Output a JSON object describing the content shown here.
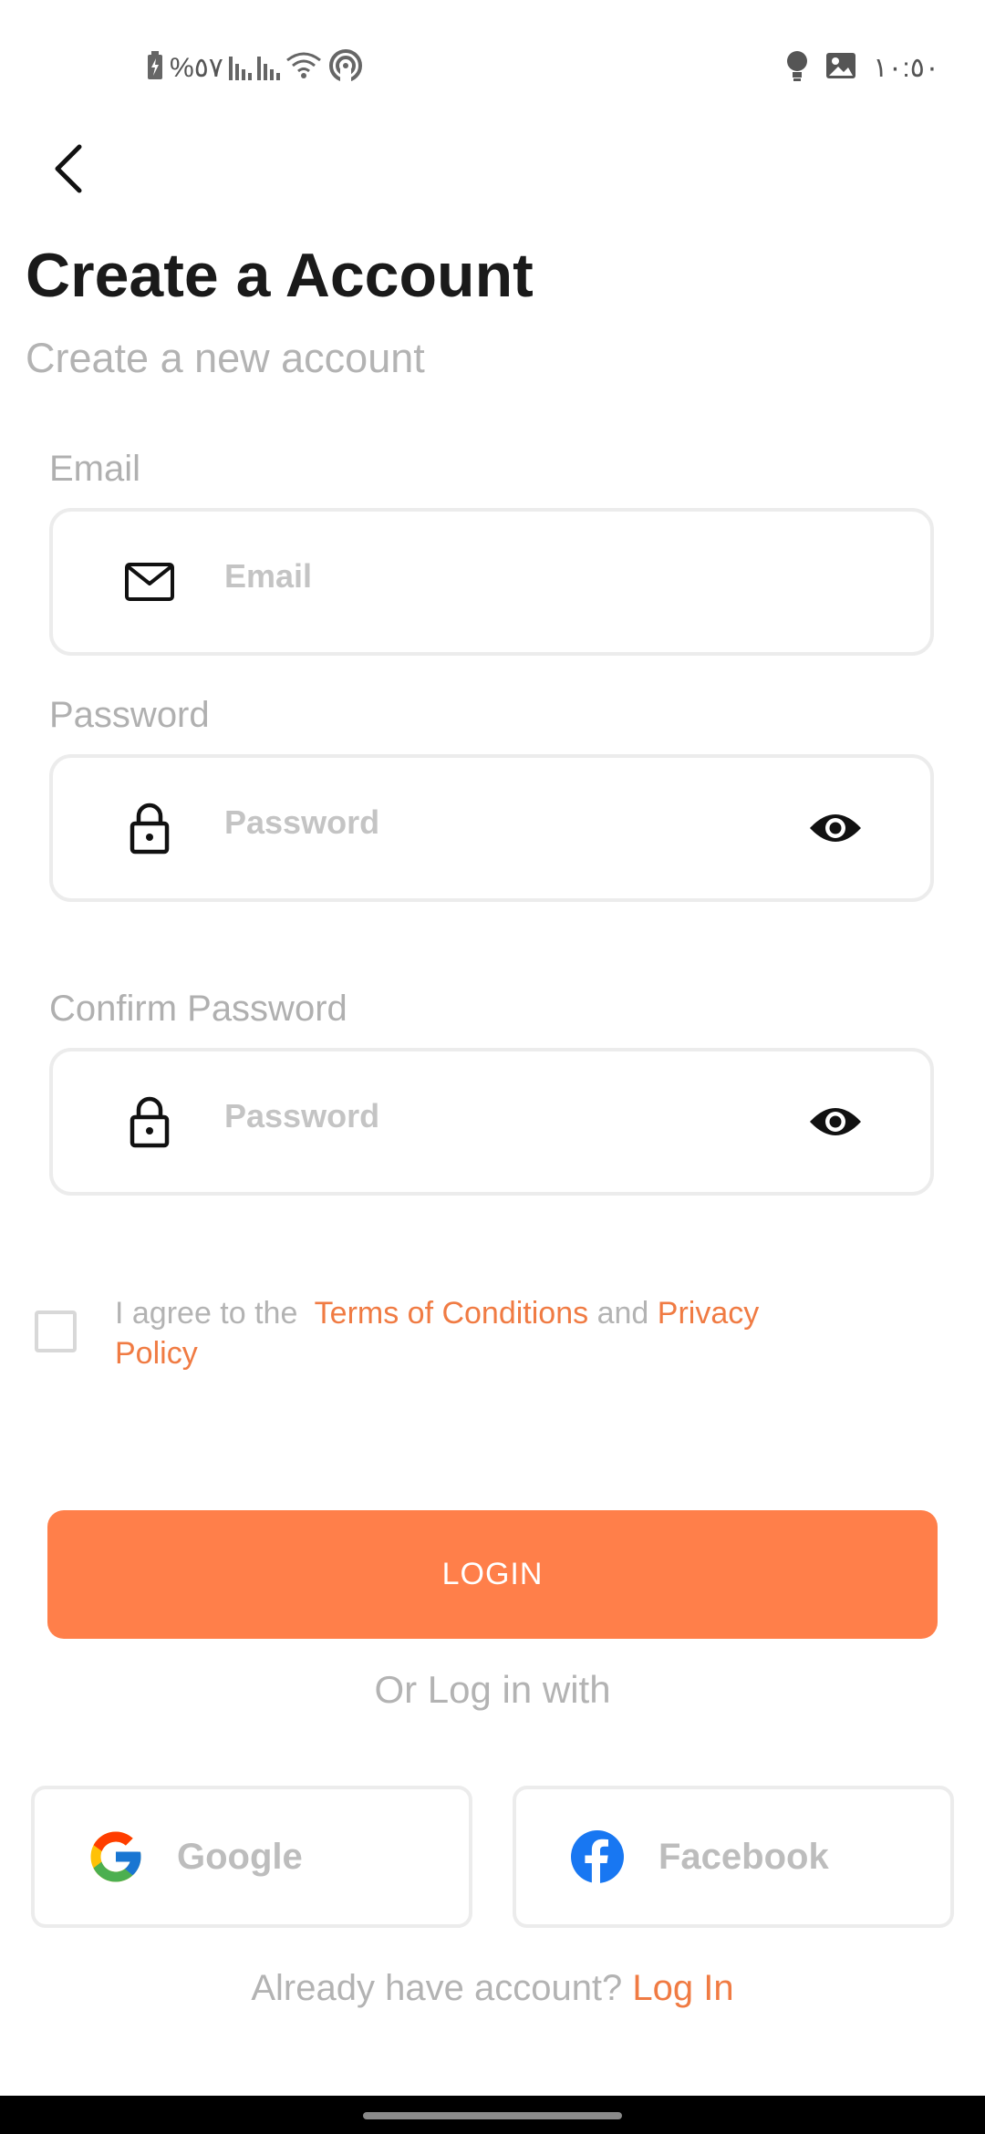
{
  "status_bar": {
    "battery_text": "%٥٧",
    "time": "١٠:٥٠"
  },
  "header": {
    "title": "Create a Account",
    "subtitle": "Create a new account"
  },
  "form": {
    "email": {
      "label": "Email",
      "placeholder": "Email",
      "value": ""
    },
    "password": {
      "label": "Password",
      "placeholder": "Password",
      "value": ""
    },
    "confirm_password": {
      "label": "Confirm Password",
      "placeholder": "Password",
      "value": ""
    }
  },
  "terms": {
    "prefix": "I agree to the",
    "terms_link": "Terms of Conditions",
    "joiner": "and",
    "privacy_link": "Privacy Policy",
    "checked": false
  },
  "login_button": {
    "label": "LOGIN"
  },
  "alt_login": {
    "text": "Or Log in with"
  },
  "social": {
    "google_label": "Google",
    "facebook_label": "Facebook"
  },
  "footer": {
    "prompt": "Already have account?",
    "link": "Log In"
  },
  "colors": {
    "accent": "#ff7f4a",
    "link": "#f07b43",
    "muted_text": "#b3b3b3",
    "border": "#ececec"
  },
  "icons": [
    "back-arrow-icon",
    "mail-icon",
    "lock-icon",
    "eye-icon",
    "google-icon",
    "facebook-icon"
  ]
}
